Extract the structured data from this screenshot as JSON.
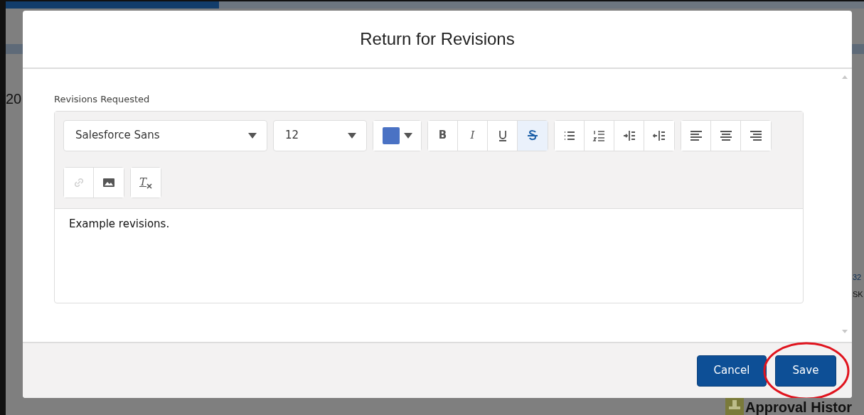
{
  "background": {
    "texts": [
      {
        "kind": "heading-left",
        "text": "20"
      },
      {
        "kind": "link-right",
        "text": "32"
      },
      {
        "kind": "note-right",
        "text": "SK"
      },
      {
        "kind": "section-title",
        "text": "Approval Histor"
      }
    ]
  },
  "modal": {
    "title": "Return for Revisions",
    "field": {
      "label": "Revisions Requested",
      "value": "Example revisions."
    },
    "toolbar": {
      "font": "Salesforce Sans",
      "size": "12",
      "color": "#4a72c4",
      "groups": [
        [
          {
            "kind": "bold",
            "glyph": "B",
            "active": false,
            "disabled": false
          },
          {
            "kind": "italic",
            "glyph": "I",
            "active": false,
            "disabled": false
          },
          {
            "kind": "underline",
            "active": false,
            "disabled": false
          },
          {
            "kind": "strike",
            "active": true,
            "disabled": false
          }
        ],
        [
          {
            "kind": "bullets",
            "active": false,
            "disabled": false
          },
          {
            "kind": "numbers",
            "active": false,
            "disabled": false
          },
          {
            "kind": "indent",
            "active": false,
            "disabled": false
          },
          {
            "kind": "outdent",
            "active": false,
            "disabled": false
          }
        ],
        [
          {
            "kind": "align-left",
            "active": false,
            "disabled": false
          },
          {
            "kind": "align-center",
            "active": false,
            "disabled": false
          },
          {
            "kind": "align-right",
            "active": false,
            "disabled": false
          }
        ],
        [
          {
            "kind": "link",
            "active": false,
            "disabled": true
          },
          {
            "kind": "image",
            "active": false,
            "disabled": false
          }
        ],
        [
          {
            "kind": "clear-format",
            "glyph": "T",
            "active": false,
            "disabled": false
          }
        ]
      ]
    },
    "buttons": [
      {
        "label": "Cancel",
        "circled": false
      },
      {
        "label": "Save",
        "circled": true
      }
    ]
  }
}
